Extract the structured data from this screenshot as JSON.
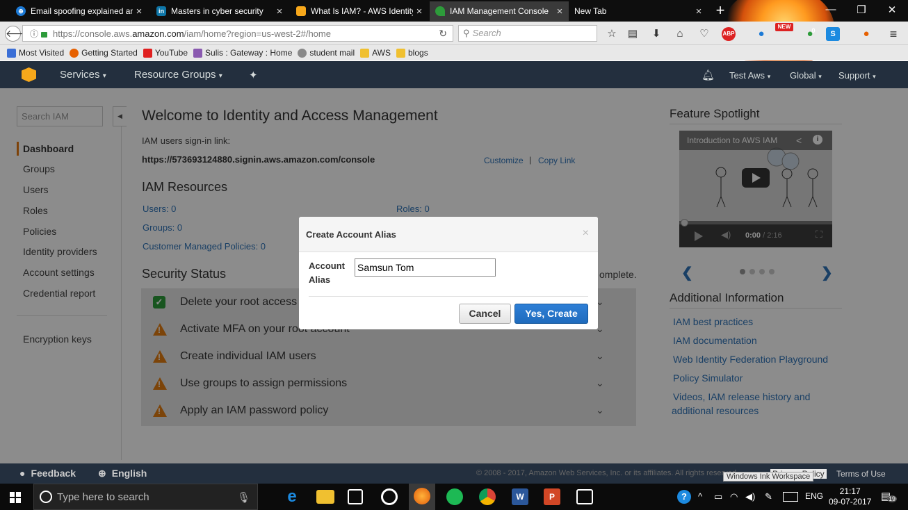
{
  "browser": {
    "tabs": [
      {
        "label": "Email spoofing explained an",
        "icon": "globe-icon",
        "color": "#1c7ad6"
      },
      {
        "label": "Masters in cyber security",
        "icon": "linkedin-icon",
        "color": "#0e76a8"
      },
      {
        "label": "What Is IAM? - AWS Identity",
        "icon": "aws-icon",
        "color": "#f7a81b"
      },
      {
        "label": "IAM Management Console",
        "icon": "leaf-icon",
        "color": "#2d9b3a",
        "active": true
      },
      {
        "label": "New Tab",
        "icon": "",
        "color": ""
      }
    ],
    "url_prefix": "https://console.aws.",
    "url_host": "amazon.com",
    "url_path": "/iam/home?region=us-west-2#/home",
    "search_placeholder": "Search",
    "bookmarks": [
      {
        "label": "Most Visited",
        "color": "#3b6fd6"
      },
      {
        "label": "Getting Started",
        "color": "#e66000"
      },
      {
        "label": "YouTube",
        "color": "#e02020"
      },
      {
        "label": "Sulis : Gateway : Home",
        "color": "#8a5ab0"
      },
      {
        "label": "student mail",
        "color": "#888888"
      },
      {
        "label": "AWS",
        "color": "#f0c030"
      },
      {
        "label": "blogs",
        "color": "#f0c030"
      }
    ],
    "addon_badges": {
      "new": "NEW",
      "count": "0"
    }
  },
  "aws_nav": {
    "services": "Services",
    "resource_groups": "Resource Groups",
    "account": "Test Aws",
    "region": "Global",
    "support": "Support"
  },
  "sidebar": {
    "search_placeholder": "Search IAM",
    "items": [
      {
        "label": "Dashboard",
        "active": true
      },
      {
        "label": "Groups"
      },
      {
        "label": "Users"
      },
      {
        "label": "Roles"
      },
      {
        "label": "Policies"
      },
      {
        "label": "Identity providers"
      },
      {
        "label": "Account settings"
      },
      {
        "label": "Credential report"
      }
    ],
    "encryption": "Encryption keys"
  },
  "main": {
    "title": "Welcome to Identity and Access Management",
    "signin_label": "IAM users sign-in link:",
    "signin_url": "https://573693124880.signin.aws.amazon.com/console",
    "customize": "Customize",
    "separator": "|",
    "copy_link": "Copy Link",
    "resources_title": "IAM Resources",
    "resources": {
      "users": "Users: 0",
      "roles": "Roles: 0",
      "groups": "Groups: 0",
      "policies": "Customer Managed Policies: 0"
    },
    "security_title": "Security Status",
    "security_suffix": "omplete.",
    "security_items": [
      {
        "label": "Delete your root access keys",
        "status": "ok"
      },
      {
        "label": "Activate MFA on your root account",
        "status": "warn"
      },
      {
        "label": "Create individual IAM users",
        "status": "warn"
      },
      {
        "label": "Use groups to assign permissions",
        "status": "warn"
      },
      {
        "label": "Apply an IAM password policy",
        "status": "warn"
      }
    ]
  },
  "spotlight": {
    "title": "Feature Spotlight",
    "video_title": "Introduction to AWS IAM",
    "time_current": "0:00",
    "time_total": " / 2:16"
  },
  "additional": {
    "title": "Additional Information",
    "links": [
      "IAM best practices",
      "IAM documentation",
      "Web Identity Federation Playground",
      "Policy Simulator",
      "Videos, IAM release history and",
      "additional resources"
    ]
  },
  "modal": {
    "title": "Create Account Alias",
    "close": "×",
    "label_line1": "Account",
    "label_line2": "Alias",
    "value": "Samsun Tom",
    "cancel": "Cancel",
    "create": "Yes, Create"
  },
  "footer": {
    "feedback": "Feedback",
    "language": "English",
    "copyright": "© 2008 - 2017, Amazon Web Services, Inc. or its affiliates. All rights reserved.",
    "privacy": "Privacy Policy",
    "terms": "Terms of Use",
    "ink_workspace": "Windows Ink Workspace"
  },
  "taskbar": {
    "search_placeholder": "Type here to search",
    "language": "ENG",
    "time": "21:17",
    "date": "09-07-2017",
    "notifications": "19"
  }
}
